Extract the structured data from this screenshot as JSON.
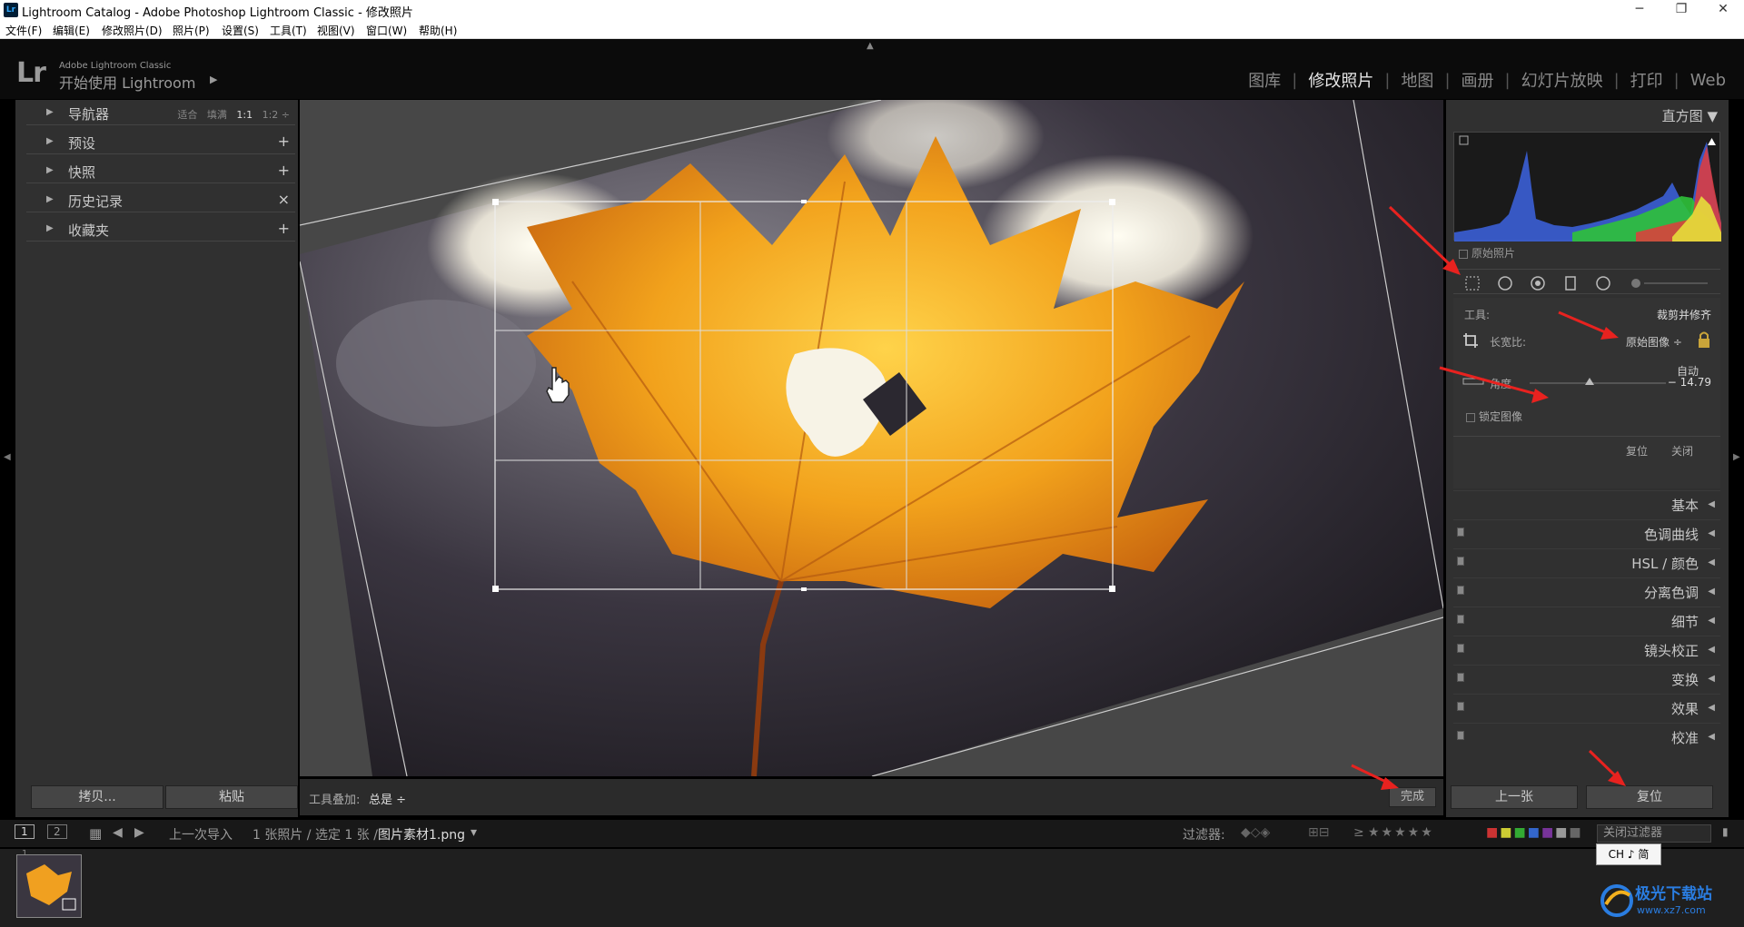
{
  "window": {
    "title": "Lightroom Catalog - Adobe Photoshop Lightroom Classic - 修改照片",
    "icon": "Lr",
    "minimize": "─",
    "maximize": "❐",
    "close": "✕"
  },
  "menu": [
    "文件(F)",
    "编辑(E)",
    "修改照片(D)",
    "照片(P)",
    "设置(S)",
    "工具(T)",
    "视图(V)",
    "窗口(W)",
    "帮助(H)"
  ],
  "identity": {
    "logo": "Lr",
    "adobe_name": "Adobe Lightroom Classic",
    "get_started": "开始使用 Lightroom",
    "get_started_arrow": "▶"
  },
  "modules": [
    {
      "label": "图库",
      "active": false
    },
    {
      "label": "修改照片",
      "active": true
    },
    {
      "label": "地图",
      "active": false
    },
    {
      "label": "画册",
      "active": false
    },
    {
      "label": "幻灯片放映",
      "active": false
    },
    {
      "label": "打印",
      "active": false
    },
    {
      "label": "Web",
      "active": false
    }
  ],
  "left_panel": {
    "navigator": {
      "label": "导航器",
      "zooms": [
        "适合",
        "填满",
        "1:1",
        "1:2"
      ]
    },
    "presets": {
      "label": "预设",
      "action": "+"
    },
    "snapshots": {
      "label": "快照",
      "action": "+"
    },
    "history": {
      "label": "历史记录",
      "action": "×"
    },
    "collections": {
      "label": "收藏夹",
      "action": "+"
    },
    "copy_button": "拷贝...",
    "paste_button": "粘贴"
  },
  "toolbar": {
    "overlay_label": "工具叠加:",
    "overlay_value": "总是 ÷",
    "done_button": "完成"
  },
  "right_panel": {
    "histogram_label": "直方图",
    "original_photo": "原始照片",
    "tool_label": "工具:",
    "tool_name": "裁剪并修齐",
    "aspect_label": "长宽比:",
    "aspect_value": "原始图像 ÷",
    "auto": "自动",
    "angle_label": "角度",
    "angle_value": "− 14.79",
    "angle_slider_fraction": 0.44,
    "constrain_label": "锁定图像",
    "reset_small": "复位",
    "close_small": "关闭",
    "sections": [
      "基本",
      "色调曲线",
      "HSL / 颜色",
      "分离色调",
      "细节",
      "镜头校正",
      "变换",
      "效果",
      "校准"
    ],
    "prev_button": "上一张",
    "reset_button": "复位"
  },
  "filmstrip": {
    "page1": "1",
    "page2": "2",
    "source": "上一次导入",
    "count": "1 张照片 / 选定 1 张 /",
    "filename": "图片素材1.png",
    "filename_arrow": "▾",
    "filter_label": "过滤器:",
    "filter_value": "关闭过滤器",
    "thumb_index": "1",
    "rating_symbol": "≥",
    "stars": "★★★★★"
  },
  "tooltip": "CH ♪ 简",
  "watermark": {
    "text1": "极光下载站",
    "text2": "www.xz7.com"
  },
  "colors": {
    "accent_red": "#e8221f",
    "leaf_orange": "#f0a020"
  }
}
